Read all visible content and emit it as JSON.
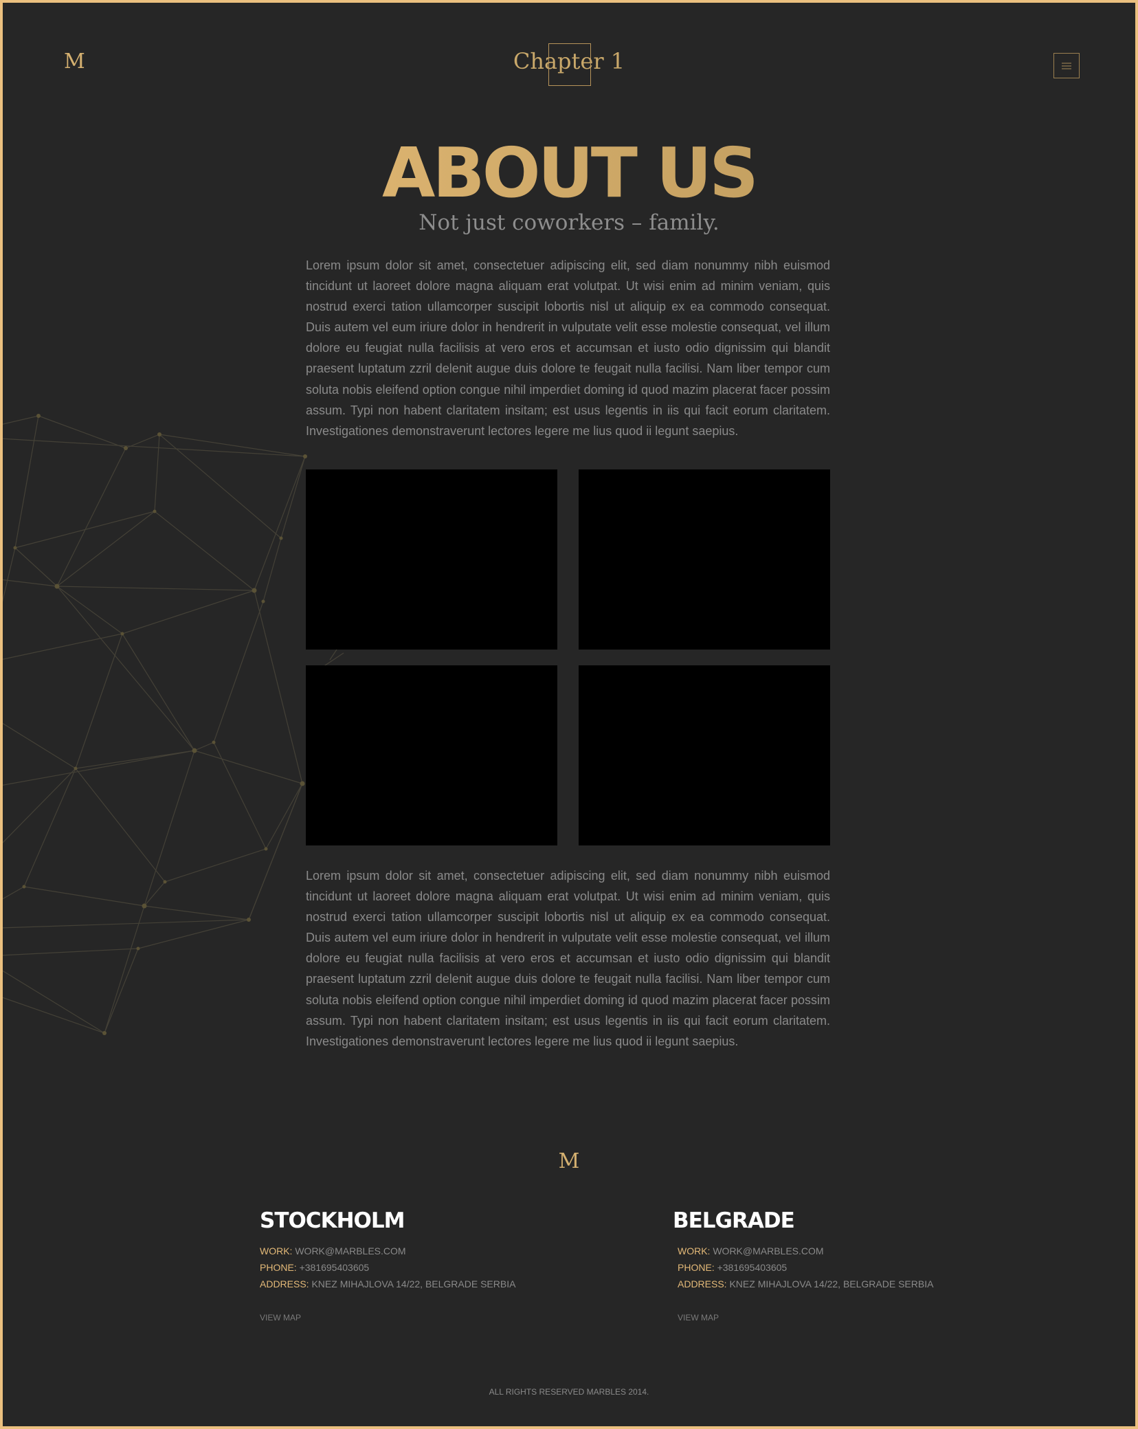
{
  "header": {
    "logo": "M",
    "title": "Chapter 1",
    "menu_icon": "hamburger-icon"
  },
  "hero": {
    "title": "ABOUT US",
    "subtitle": "Not just coworkers – family."
  },
  "content": {
    "paragraph_1": "Lorem ipsum dolor sit amet, consectetuer adipiscing elit, sed diam nonummy nibh euismod tincidunt ut laoreet dolore magna aliquam erat volutpat. Ut wisi enim ad minim veniam, quis nostrud exerci tation ullamcorper suscipit lobortis nisl ut aliquip ex ea commodo consequat. Duis autem vel eum iriure dolor in hendrerit in vulputate velit esse molestie consequat, vel illum dolore eu feugiat nulla facilisis at vero eros et accumsan et iusto odio dignissim qui blandit praesent luptatum zzril delenit augue duis dolore te feugait nulla facilisi. Nam liber tempor cum soluta nobis eleifend option congue nihil imperdiet doming id quod mazim placerat facer possim assum. Typi non habent claritatem insitam; est usus legentis in iis qui facit eorum claritatem. Investigationes demonstraverunt lectores legere me lius quod ii legunt saepius.",
    "paragraph_2": "Lorem ipsum dolor sit amet, consectetuer adipiscing elit, sed diam nonummy nibh euismod tincidunt ut laoreet dolore magna aliquam erat volutpat. Ut wisi enim ad minim veniam, quis nostrud exerci tation ullamcorper suscipit lobortis nisl ut aliquip ex ea commodo consequat. Duis autem vel eum iriure dolor in hendrerit in vulputate velit esse molestie consequat, vel illum dolore eu feugiat nulla facilisis at vero eros et accumsan et iusto odio dignissim qui blandit praesent luptatum zzril delenit augue duis dolore te feugait nulla facilisi. Nam liber tempor cum soluta nobis eleifend option congue nihil imperdiet doming id quod mazim placerat facer possim assum. Typi non habent claritatem insitam; est usus legentis in iis qui facit eorum claritatem. Investigationes demonstraverunt lectores legere me lius quod ii legunt saepius."
  },
  "footer": {
    "logo": "M",
    "offices": [
      {
        "city": "STOCKHOLM",
        "work_label": "WORK:",
        "work": "WORK@MARBLES.COM",
        "phone_label": "PHONE:",
        "phone": "+381695403605",
        "address_label": "ADDRESS:",
        "address": "KNEZ MIHAJLOVA 14/22, BELGRADE SERBIA",
        "map_link": "VIEW MAP"
      },
      {
        "city": "BELGRADE",
        "work_label": "WORK:",
        "work": "WORK@MARBLES.COM",
        "phone_label": "PHONE:",
        "phone": "+381695403605",
        "address_label": "ADDRESS:",
        "address": "KNEZ MIHAJLOVA 14/22, BELGRADE SERBIA",
        "map_link": "VIEW MAP"
      }
    ],
    "copyright": "ALL RIGHTS RESERVED MARBLES 2014."
  },
  "colors": {
    "background": "#262626",
    "accent": "#ebc07f",
    "text": "#8a8a8a"
  }
}
